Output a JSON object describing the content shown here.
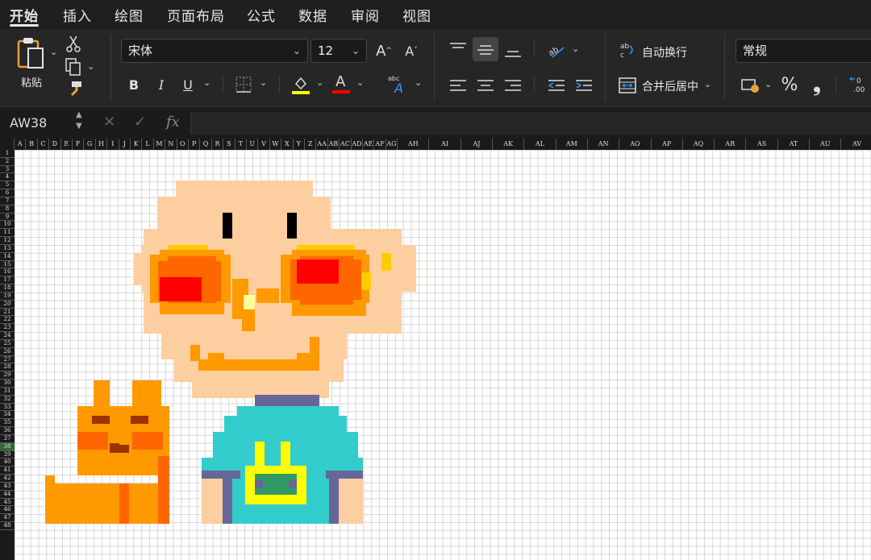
{
  "tabs": [
    "开始",
    "插入",
    "绘图",
    "页面布局",
    "公式",
    "数据",
    "审阅",
    "视图"
  ],
  "ribbon": {
    "paste_label": "粘贴",
    "font_name": "宋体",
    "font_size": "12",
    "wrap_text_label": "自动换行",
    "merge_center_label": "合并后居中",
    "number_format": "常规",
    "bold": "B",
    "italic": "I",
    "underline": "U",
    "percent": "%",
    "comma": "❟",
    "grow_font": "A",
    "shrink_font": "A",
    "abc": "abc"
  },
  "formula_bar": {
    "name_box": "AW38",
    "fx": "fx",
    "value": ""
  },
  "columns": [
    "A",
    "B",
    "C",
    "D",
    "E",
    "F",
    "G",
    "H",
    "I",
    "J",
    "K",
    "L",
    "M",
    "N",
    "O",
    "P",
    "Q",
    "R",
    "S",
    "T",
    "U",
    "V",
    "W",
    "X",
    "Y",
    "Z",
    "AA",
    "AB",
    "AC",
    "AD",
    "AE",
    "AF",
    "AG",
    "AH",
    "AI",
    "AJ",
    "AK",
    "AL",
    "AM",
    "AN",
    "AO",
    "AP",
    "AQ",
    "AR",
    "AS",
    "AT",
    "AU",
    "AV"
  ],
  "rows": [
    "1",
    "2",
    "3",
    "4",
    "5",
    "6",
    "7",
    "8",
    "9",
    "10",
    "11",
    "12",
    "13",
    "14",
    "15",
    "16",
    "17",
    "18",
    "19",
    "20",
    "21",
    "22",
    "23",
    "24",
    "25",
    "26",
    "27",
    "28",
    "29",
    "30",
    "31",
    "32",
    "33",
    "34",
    "35",
    "36",
    "37",
    "38",
    "39",
    "40",
    "41",
    "42",
    "43",
    "44",
    "45",
    "46",
    "47",
    "48"
  ],
  "colors": {
    "skin": "#fccea0",
    "orange": "#ff9900",
    "dark_orange": "#ff6600",
    "red": "#ff0000",
    "yellow": "#ffcc00",
    "black": "#000000",
    "teal": "#33cccc",
    "purple": "#666699",
    "bright_yellow": "#ffff00",
    "green": "#339966",
    "brown": "#993300",
    "pale_yellow": "#ffff99",
    "red_font_bar": "#ff0000",
    "yellow_fill_bar": "#ffff00"
  }
}
